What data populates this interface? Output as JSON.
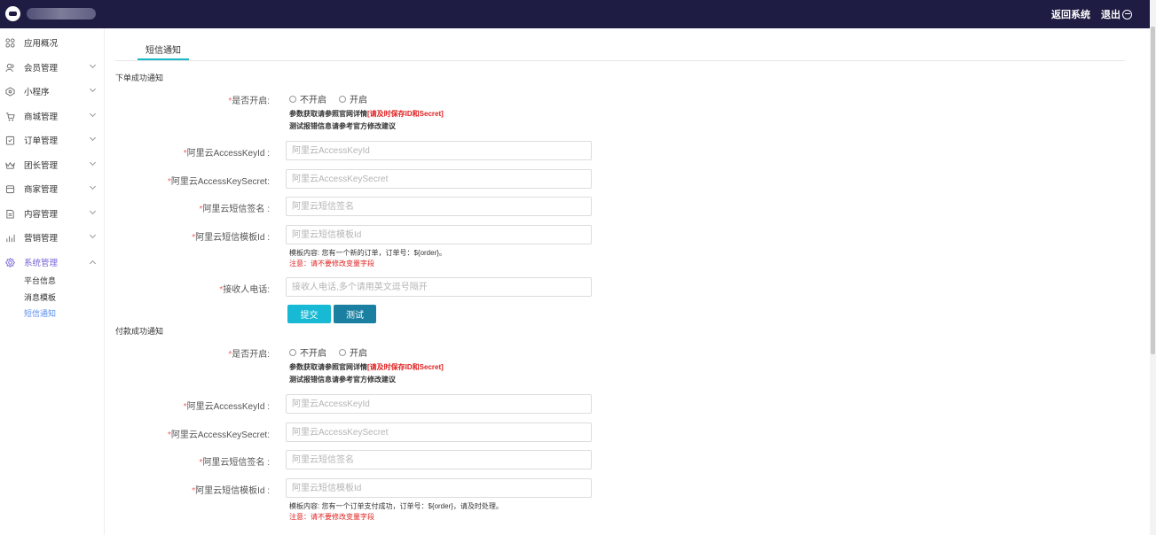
{
  "topbar": {
    "back_label": "返回系统",
    "logout_label": "退出"
  },
  "sidebar": {
    "items": [
      {
        "label": "应用概况",
        "icon": "grid-icon"
      },
      {
        "label": "会员管理",
        "icon": "users-icon"
      },
      {
        "label": "小程序",
        "icon": "miniprogram-icon"
      },
      {
        "label": "商城管理",
        "icon": "cart-icon"
      },
      {
        "label": "订单管理",
        "icon": "order-icon"
      },
      {
        "label": "团长管理",
        "icon": "crown-icon"
      },
      {
        "label": "商家管理",
        "icon": "store-icon"
      },
      {
        "label": "内容管理",
        "icon": "document-icon"
      },
      {
        "label": "营销管理",
        "icon": "chart-icon"
      },
      {
        "label": "系统管理",
        "icon": "gear-icon"
      }
    ],
    "sub_items": [
      "平台信息",
      "消息模板",
      "短信通知"
    ]
  },
  "tab_label": "短信通知",
  "section1": {
    "title": "下单成功通知",
    "enable_label": "是否开启:",
    "option_off": "不开启",
    "option_on": "开启",
    "hint_line1": "参数获取请参照官网详情",
    "hint_line1_red": "[请及时保存ID和Secret]",
    "hint_line2": "测试报错信息请参考官方修改建议",
    "keyid_label": "阿里云AccessKeyId :",
    "keyid_placeholder": "阿里云AccessKeyId",
    "secret_label": "阿里云AccessKeySecret:",
    "secret_placeholder": "阿里云AccessKeySecret",
    "sign_label": "阿里云短信签名 :",
    "sign_placeholder": "阿里云短信签名",
    "template_label": "阿里云短信模板Id :",
    "template_placeholder": "阿里云短信模板Id",
    "template_content": "模板内容: 您有一个新的订单，订单号：${order}。",
    "template_warn": "注意：请不要修改变量字段",
    "phone_label": "接收人电话:",
    "phone_placeholder": "接收人电话,多个请用英文逗号隔开",
    "submit_label": "提交",
    "test_label": "测试"
  },
  "section2": {
    "title": "付款成功通知",
    "enable_label": "是否开启:",
    "option_off": "不开启",
    "option_on": "开启",
    "hint_line1": "参数获取请参照官网详情",
    "hint_line1_red": "[请及时保存ID和Secret]",
    "hint_line2": "测试报错信息请参考官方修改建议",
    "keyid_label": "阿里云AccessKeyId :",
    "keyid_placeholder": "阿里云AccessKeyId",
    "secret_label": "阿里云AccessKeySecret:",
    "secret_placeholder": "阿里云AccessKeySecret",
    "sign_label": "阿里云短信签名 :",
    "sign_placeholder": "阿里云短信签名",
    "template_label": "阿里云短信模板Id :",
    "template_placeholder": "阿里云短信模板Id",
    "template_content": "模板内容: 您有一个订单支付成功，订单号：${order}，请及时处理。",
    "template_warn": "注意：请不要修改变量字段"
  },
  "required_mark": "*"
}
